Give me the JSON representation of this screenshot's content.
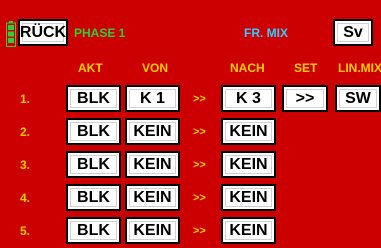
{
  "header": {
    "back_label": "RÜCK",
    "phase_label": "PHASE 1",
    "title": "FR. MIX",
    "sv_label": "Sv"
  },
  "columns": {
    "akt": "AKT",
    "von": "VON",
    "nach": "NACH",
    "set": "SET",
    "linmix": "LIN.MIX"
  },
  "rows": [
    {
      "num": "1.",
      "akt": "BLK",
      "von": "K 1",
      "arrow": ">>",
      "nach": "K 3",
      "set": ">>",
      "linmix": "SW"
    },
    {
      "num": "2.",
      "akt": "BLK",
      "von": "KEIN",
      "arrow": ">>",
      "nach": "KEIN"
    },
    {
      "num": "3.",
      "akt": "BLK",
      "von": "KEIN",
      "arrow": ">>",
      "nach": "KEIN"
    },
    {
      "num": "4.",
      "akt": "BLK",
      "von": "KEIN",
      "arrow": ">>",
      "nach": "KEIN"
    },
    {
      "num": "5.",
      "akt": "BLK",
      "von": "KEIN",
      "arrow": ">>",
      "nach": "KEIN"
    }
  ],
  "colors": {
    "background": "#cc0000",
    "label_yellow": "#ffcc00",
    "phase_green": "#33cc33",
    "title_cyan": "#33ccff"
  },
  "icons": {
    "battery": "battery-icon"
  }
}
